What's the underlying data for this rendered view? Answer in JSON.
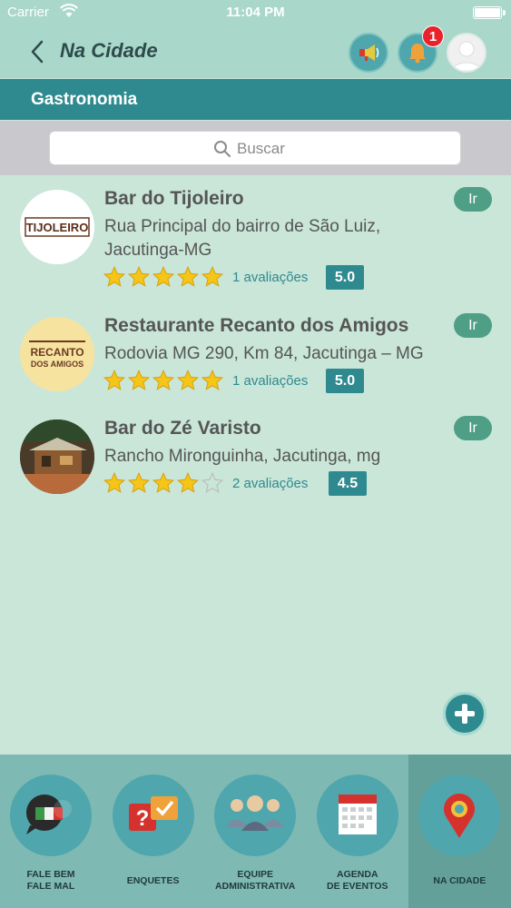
{
  "statusbar": {
    "carrier": "Carrier",
    "time": "11:04 PM"
  },
  "nav": {
    "title": "Na Cidade",
    "notification_count": "1"
  },
  "section": {
    "title": "Gastronomia"
  },
  "search": {
    "placeholder": "Buscar"
  },
  "places": [
    {
      "name": "Bar do Tijoleiro",
      "address": "Rua Principal do bairro de São Luiz, Jacutinga-MG",
      "rating": 5,
      "reviews": "1 avaliações",
      "score": "5.0",
      "go": "Ir",
      "thumb_text": "TIJOLEIRO"
    },
    {
      "name": "Restaurante Recanto dos Amigos",
      "address": "Rodovia MG 290, Km 84, Jacutinga – MG",
      "rating": 5,
      "reviews": "1 avaliações",
      "score": "5.0",
      "go": "Ir",
      "thumb_text_1": "RECANTO",
      "thumb_text_2": "DOS AMIGOS"
    },
    {
      "name": "Bar do Zé Varisto",
      "address": "Rancho Mironguinha, Jacutinga, mg",
      "rating": 4,
      "reviews": "2 avaliações",
      "score": "4.5",
      "go": "Ir"
    }
  ],
  "tabs": [
    {
      "label_1": "FALE BEM",
      "label_2": "FALE MAL",
      "icon": "chat-bubbles-icon"
    },
    {
      "label_1": "ENQUETES",
      "label_2": "",
      "icon": "poll-icon"
    },
    {
      "label_1": "EQUIPE",
      "label_2": "ADMINISTRATIVA",
      "icon": "team-icon"
    },
    {
      "label_1": "AGENDA",
      "label_2": "DE EVENTOS",
      "icon": "calendar-icon"
    },
    {
      "label_1": "NA CIDADE",
      "label_2": "",
      "icon": "map-pin-icon"
    }
  ],
  "colors": {
    "header": "#a9d7ca",
    "section": "#2f8a8f",
    "background": "#c9e6d9",
    "star": "#f5c518",
    "go_button": "#4f9e86"
  }
}
